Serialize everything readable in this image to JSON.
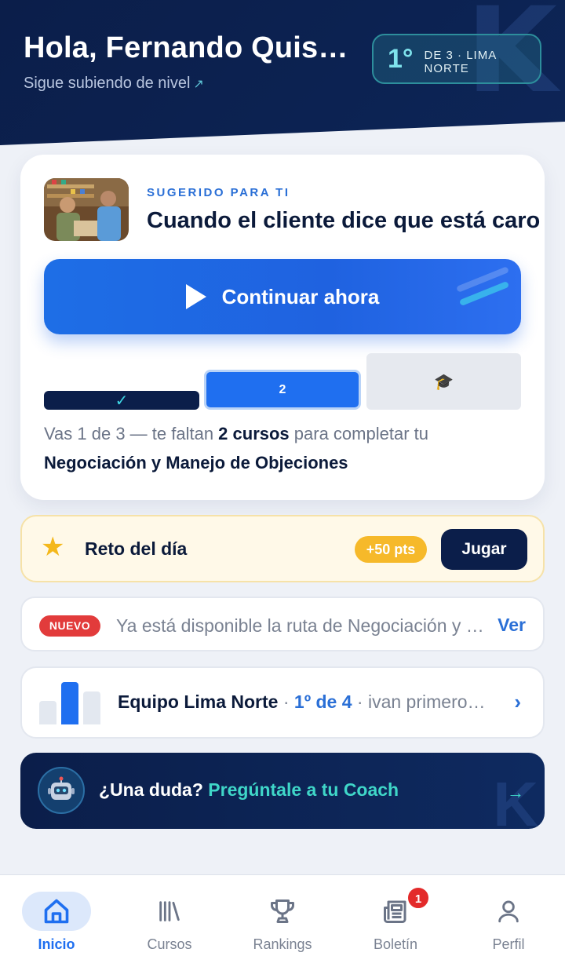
{
  "header": {
    "greeting": "Hola, Fernando Quisp...",
    "subtitle": "Sigue subiendo de nivel",
    "rank_position": "1°",
    "rank_detail": "DE 3 · LIMA NORTE"
  },
  "suggested": {
    "eyebrow": "SUGERIDO PARA TI",
    "title": "Cuando el cliente dice que está caro",
    "cta_label": "Continuar ahora",
    "steps": [
      {
        "label": "✓",
        "state": "done"
      },
      {
        "label": "2",
        "state": "current"
      },
      {
        "label": "🎓",
        "state": "locked"
      }
    ],
    "progress_pre": "Vas 1 de 3 — te faltan ",
    "progress_bold": "2 cursos",
    "progress_post": " para completar tu",
    "path_name": "Negociación y Manejo de Objeciones"
  },
  "challenge": {
    "icon": "star-icon",
    "label": "Reto del día",
    "points": "+50 pts",
    "button": "Jugar"
  },
  "announcement": {
    "badge": "NUEVO",
    "message": "Ya está disponible la ruta de Negociación y Manejo de Objeciones",
    "link": "Ver"
  },
  "team": {
    "name": "Equipo Lima Norte",
    "sep1": " · ",
    "rank": "1º de 4",
    "sep2": " · ",
    "detail": "ivan primero del equipo"
  },
  "coach": {
    "question": "¿Una duda?",
    "highlight": "Pregúntale a tu Coach",
    "arrow": "→"
  },
  "nav": {
    "items": [
      {
        "label": "Inicio",
        "icon": "home-icon",
        "active": true
      },
      {
        "label": "Cursos",
        "icon": "library-icon"
      },
      {
        "label": "Rankings",
        "icon": "trophy-icon"
      },
      {
        "label": "Boletín",
        "icon": "newspaper-icon",
        "badge": "1"
      },
      {
        "label": "Perfil",
        "icon": "user-icon"
      }
    ]
  },
  "colors": {
    "primary": "#1f6ff0",
    "navy": "#0b1e4a",
    "accent_teal": "#3fd6c8",
    "gold": "#f6b92a",
    "alert": "#e23b3b"
  }
}
